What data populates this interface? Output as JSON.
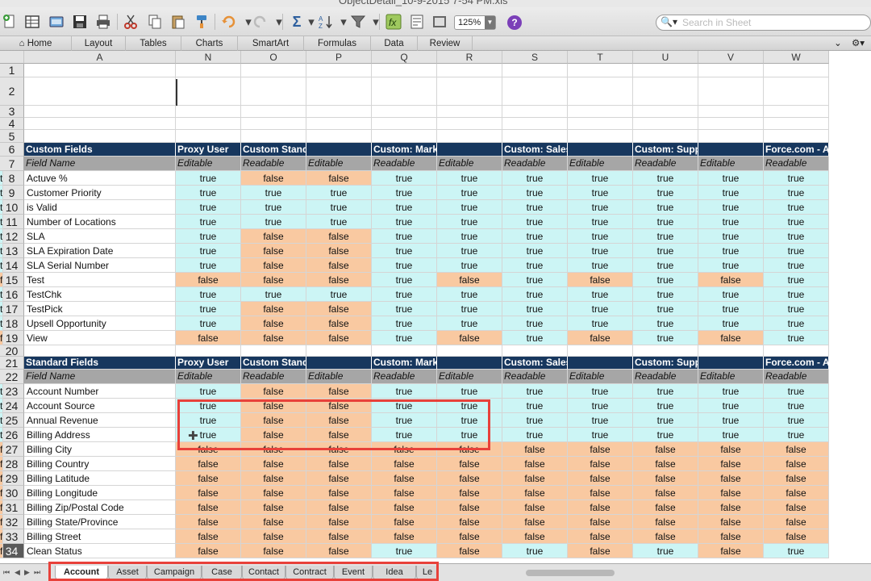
{
  "window": {
    "title": "ObjectDetail_10-9-2015 7-54 PM.xls"
  },
  "toolbar": {
    "zoom": "125%",
    "help": "?",
    "search_placeholder": "Search in Sheet",
    "icons": [
      "new-icon",
      "gallery-icon",
      "open-icon",
      "save-icon",
      "print-icon",
      "cut-icon",
      "copy-icon",
      "paste-icon",
      "format-icon",
      "undo-icon",
      "redo-icon",
      "autosum-icon",
      "sort-icon",
      "filter-icon",
      "function-icon",
      "show-icon"
    ]
  },
  "ribbon": {
    "tabs": [
      "Home",
      "Layout",
      "Tables",
      "Charts",
      "SmartArt",
      "Formulas",
      "Data",
      "Review"
    ]
  },
  "columns": [
    "A",
    "N",
    "O",
    "P",
    "Q",
    "R",
    "S",
    "T",
    "U",
    "V",
    "W"
  ],
  "sections": {
    "custom": {
      "header": [
        "Custom Fields",
        "Proxy User",
        "Custom Standard",
        "",
        "Custom: Marketing Profile",
        "",
        "Custom: Sales Profile",
        "",
        "Custom: Support Profile",
        "",
        "Force.com - App Subscr"
      ],
      "sub": [
        "Field Name",
        "Editable",
        "Readable",
        "Editable",
        "Readable",
        "Editable",
        "Readable",
        "Editable",
        "Readable",
        "Editable",
        "Readable"
      ]
    },
    "standard": {
      "header": [
        "Standard Fields",
        "Proxy User",
        "Custom Standard",
        "",
        "Custom: Marketing Profile",
        "",
        "Custom: Sales Profile",
        "",
        "Custom: Support Profile",
        "",
        "Force.com - App Subscr"
      ],
      "sub": [
        "Field Name",
        "Editable",
        "Readable",
        "Editable",
        "Readable",
        "Editable",
        "Readable",
        "Editable",
        "Readable",
        "Editable",
        "Readable"
      ]
    }
  },
  "rows": [
    {
      "n": "1"
    },
    {
      "n": "2"
    },
    {
      "n": "3"
    },
    {
      "n": "4"
    },
    {
      "n": "5"
    },
    {
      "n": "6",
      "section": "custom",
      "kind": "header"
    },
    {
      "n": "7",
      "section": "custom",
      "kind": "sub"
    },
    {
      "n": "8",
      "label": "Actuve %",
      "vals": [
        "true",
        "false",
        "false",
        "true",
        "true",
        "true",
        "true",
        "true",
        "true",
        "true",
        "t"
      ]
    },
    {
      "n": "9",
      "label": "Customer Priority",
      "vals": [
        "true",
        "true",
        "true",
        "true",
        "true",
        "true",
        "true",
        "true",
        "true",
        "true",
        "t"
      ]
    },
    {
      "n": "10",
      "label": "is Valid",
      "vals": [
        "true",
        "true",
        "true",
        "true",
        "true",
        "true",
        "true",
        "true",
        "true",
        "true",
        "t"
      ]
    },
    {
      "n": "11",
      "label": "Number of Locations",
      "vals": [
        "true",
        "true",
        "true",
        "true",
        "true",
        "true",
        "true",
        "true",
        "true",
        "true",
        "t"
      ]
    },
    {
      "n": "12",
      "label": "SLA",
      "vals": [
        "true",
        "false",
        "false",
        "true",
        "true",
        "true",
        "true",
        "true",
        "true",
        "true",
        "t"
      ]
    },
    {
      "n": "13",
      "label": "SLA Expiration Date",
      "vals": [
        "true",
        "false",
        "false",
        "true",
        "true",
        "true",
        "true",
        "true",
        "true",
        "true",
        "t"
      ]
    },
    {
      "n": "14",
      "label": "SLA Serial Number",
      "vals": [
        "true",
        "false",
        "false",
        "true",
        "true",
        "true",
        "true",
        "true",
        "true",
        "true",
        "t"
      ]
    },
    {
      "n": "15",
      "label": "Test",
      "vals": [
        "false",
        "false",
        "false",
        "true",
        "false",
        "true",
        "false",
        "true",
        "false",
        "true",
        "f"
      ]
    },
    {
      "n": "16",
      "label": "TestChk",
      "vals": [
        "true",
        "true",
        "true",
        "true",
        "true",
        "true",
        "true",
        "true",
        "true",
        "true",
        "t"
      ]
    },
    {
      "n": "17",
      "label": "TestPick",
      "vals": [
        "true",
        "false",
        "false",
        "true",
        "true",
        "true",
        "true",
        "true",
        "true",
        "true",
        "t"
      ]
    },
    {
      "n": "18",
      "label": "Upsell Opportunity",
      "vals": [
        "true",
        "false",
        "false",
        "true",
        "true",
        "true",
        "true",
        "true",
        "true",
        "true",
        "t"
      ]
    },
    {
      "n": "19",
      "label": "View",
      "vals": [
        "false",
        "false",
        "false",
        "true",
        "false",
        "true",
        "false",
        "true",
        "false",
        "true",
        "f"
      ]
    },
    {
      "n": "20"
    },
    {
      "n": "21",
      "section": "standard",
      "kind": "header"
    },
    {
      "n": "22",
      "section": "standard",
      "kind": "sub"
    },
    {
      "n": "23",
      "label": "Account Number",
      "vals": [
        "true",
        "false",
        "false",
        "true",
        "true",
        "true",
        "true",
        "true",
        "true",
        "true",
        "t"
      ]
    },
    {
      "n": "24",
      "label": "Account Source",
      "vals": [
        "true",
        "false",
        "false",
        "true",
        "true",
        "true",
        "true",
        "true",
        "true",
        "true",
        "t"
      ]
    },
    {
      "n": "25",
      "label": "Annual Revenue",
      "vals": [
        "true",
        "false",
        "false",
        "true",
        "true",
        "true",
        "true",
        "true",
        "true",
        "true",
        "t"
      ]
    },
    {
      "n": "26",
      "label": "Billing Address",
      "vals": [
        "true",
        "false",
        "false",
        "true",
        "true",
        "true",
        "true",
        "true",
        "true",
        "true",
        "t"
      ]
    },
    {
      "n": "27",
      "label": "Billing City",
      "vals": [
        "false",
        "false",
        "false",
        "false",
        "false",
        "false",
        "false",
        "false",
        "false",
        "false",
        "f"
      ]
    },
    {
      "n": "28",
      "label": "Billing Country",
      "vals": [
        "false",
        "false",
        "false",
        "false",
        "false",
        "false",
        "false",
        "false",
        "false",
        "false",
        "f"
      ]
    },
    {
      "n": "29",
      "label": "Billing Latitude",
      "vals": [
        "false",
        "false",
        "false",
        "false",
        "false",
        "false",
        "false",
        "false",
        "false",
        "false",
        "f"
      ]
    },
    {
      "n": "30",
      "label": "Billing Longitude",
      "vals": [
        "false",
        "false",
        "false",
        "false",
        "false",
        "false",
        "false",
        "false",
        "false",
        "false",
        "f"
      ]
    },
    {
      "n": "31",
      "label": "Billing Zip/Postal Code",
      "vals": [
        "false",
        "false",
        "false",
        "false",
        "false",
        "false",
        "false",
        "false",
        "false",
        "false",
        "f"
      ]
    },
    {
      "n": "32",
      "label": "Billing State/Province",
      "vals": [
        "false",
        "false",
        "false",
        "false",
        "false",
        "false",
        "false",
        "false",
        "false",
        "false",
        "f"
      ]
    },
    {
      "n": "33",
      "label": "Billing Street",
      "vals": [
        "false",
        "false",
        "false",
        "false",
        "false",
        "false",
        "false",
        "false",
        "false",
        "false",
        "f"
      ]
    },
    {
      "n": "34",
      "label": "Clean Status",
      "vals": [
        "false",
        "false",
        "false",
        "true",
        "false",
        "true",
        "false",
        "true",
        "false",
        "true",
        "f"
      ]
    }
  ],
  "sheet_tabs": {
    "items": [
      "Account",
      "Asset",
      "Campaign",
      "Case",
      "Contact",
      "Contract",
      "Event",
      "Idea",
      "Le"
    ],
    "active": "Account"
  },
  "colors": {
    "true_fill": "#ccf5f5",
    "false_fill": "#f9c9a1",
    "header_fill": "#17375e",
    "subheader_fill": "#a6a6a6",
    "highlight": "#e8413a"
  }
}
